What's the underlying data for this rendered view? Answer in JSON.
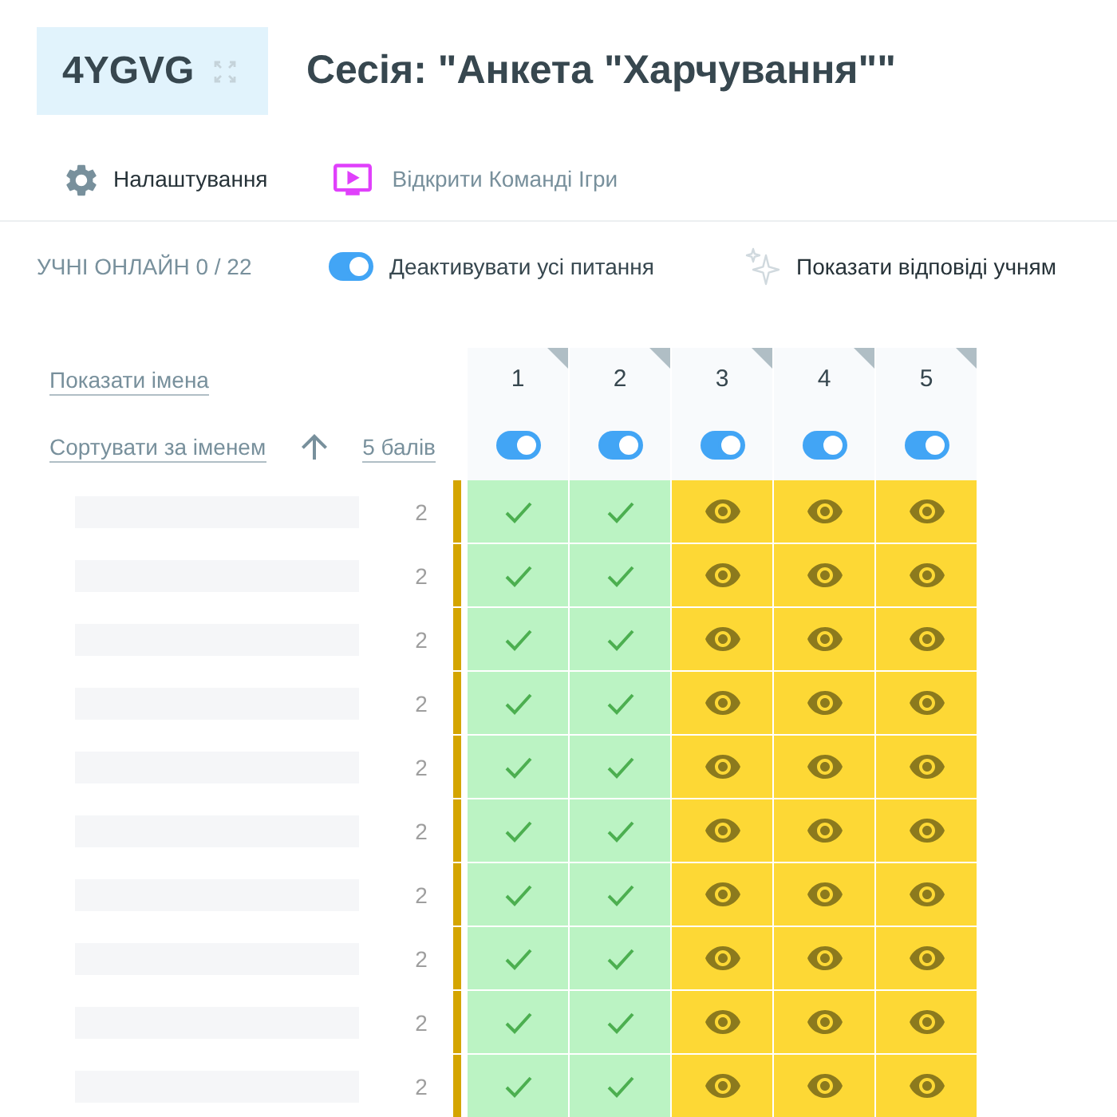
{
  "session": {
    "code": "4YGVG",
    "title": "Сесія: \"Анкета \"Харчування\"\""
  },
  "nav": [
    {
      "kind": "settings",
      "label": "Налаштування"
    },
    {
      "kind": "present",
      "label": "Відкрити Команді Ігри"
    }
  ],
  "toolbar": {
    "online": "УЧНІ ОНЛАЙН 0 / 22",
    "deactivate_all": {
      "label": "Деактивувати усі питання",
      "on": true
    },
    "show_answers": {
      "label": "Показати відповіді учням"
    }
  },
  "table": {
    "show_names": "Показати імена",
    "sort_by_name": "Сортувати за іменем",
    "points": "5 балів",
    "questions": [
      {
        "label": "1",
        "on": true
      },
      {
        "label": "2",
        "on": true
      },
      {
        "label": "3",
        "on": true
      },
      {
        "label": "4",
        "on": true
      },
      {
        "label": "5",
        "on": true
      }
    ],
    "rows": [
      {
        "score": "2",
        "cells": [
          {
            "kind": "correct"
          },
          {
            "kind": "correct"
          },
          {
            "kind": "viewing"
          },
          {
            "kind": "viewing"
          },
          {
            "kind": "viewing"
          }
        ]
      },
      {
        "score": "2",
        "cells": [
          {
            "kind": "correct"
          },
          {
            "kind": "correct"
          },
          {
            "kind": "viewing"
          },
          {
            "kind": "viewing"
          },
          {
            "kind": "viewing"
          }
        ]
      },
      {
        "score": "2",
        "cells": [
          {
            "kind": "correct"
          },
          {
            "kind": "correct"
          },
          {
            "kind": "viewing"
          },
          {
            "kind": "viewing"
          },
          {
            "kind": "viewing"
          }
        ]
      },
      {
        "score": "2",
        "cells": [
          {
            "kind": "correct"
          },
          {
            "kind": "correct"
          },
          {
            "kind": "viewing"
          },
          {
            "kind": "viewing"
          },
          {
            "kind": "viewing"
          }
        ]
      },
      {
        "score": "2",
        "cells": [
          {
            "kind": "correct"
          },
          {
            "kind": "correct"
          },
          {
            "kind": "viewing"
          },
          {
            "kind": "viewing"
          },
          {
            "kind": "viewing"
          }
        ]
      },
      {
        "score": "2",
        "cells": [
          {
            "kind": "correct"
          },
          {
            "kind": "correct"
          },
          {
            "kind": "viewing"
          },
          {
            "kind": "viewing"
          },
          {
            "kind": "viewing"
          }
        ]
      },
      {
        "score": "2",
        "cells": [
          {
            "kind": "correct"
          },
          {
            "kind": "correct"
          },
          {
            "kind": "viewing"
          },
          {
            "kind": "viewing"
          },
          {
            "kind": "viewing"
          }
        ]
      },
      {
        "score": "2",
        "cells": [
          {
            "kind": "correct"
          },
          {
            "kind": "correct"
          },
          {
            "kind": "viewing"
          },
          {
            "kind": "viewing"
          },
          {
            "kind": "viewing"
          }
        ]
      },
      {
        "score": "2",
        "cells": [
          {
            "kind": "correct"
          },
          {
            "kind": "correct"
          },
          {
            "kind": "viewing"
          },
          {
            "kind": "viewing"
          },
          {
            "kind": "viewing"
          }
        ]
      },
      {
        "score": "2",
        "cells": [
          {
            "kind": "correct"
          },
          {
            "kind": "correct"
          },
          {
            "kind": "viewing"
          },
          {
            "kind": "viewing"
          },
          {
            "kind": "viewing"
          }
        ]
      }
    ]
  }
}
